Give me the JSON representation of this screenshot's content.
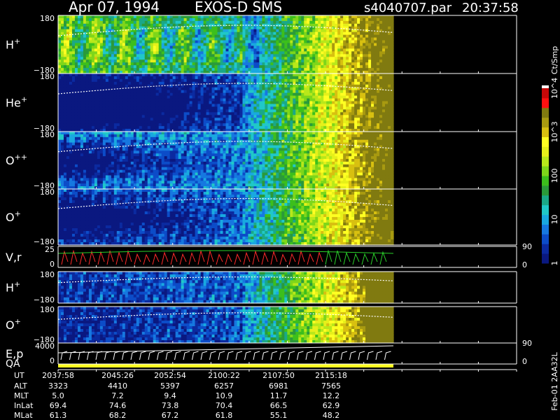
{
  "header": {
    "date": "Apr 07, 1994",
    "mission": "EXOS-D SMS",
    "file": "s4040707.par",
    "time": "20:37:58"
  },
  "chart_data": {
    "type": "heatmap",
    "title": "Apr 07, 1994   EXOS-D SMS",
    "colorbar": {
      "label": "Ct/Smp",
      "scale": "log",
      "range": [
        1,
        10000
      ],
      "ticks": [
        "1",
        "10",
        "100",
        "10^3",
        "10^4"
      ]
    },
    "panels": [
      {
        "id": "h-plus-1",
        "label": "H",
        "sup": "+",
        "ymin": "−180",
        "ymax": "180"
      },
      {
        "id": "he-plus",
        "label": "He",
        "sup": "+",
        "ymin": "−180",
        "ymax": "180"
      },
      {
        "id": "o-plusplus",
        "label": "O",
        "sup": "++",
        "ymin": "−180",
        "ymax": "180"
      },
      {
        "id": "o-plus-1",
        "label": "O",
        "sup": "+",
        "ymin": "−180",
        "ymax": "180"
      },
      {
        "id": "vr",
        "label": "V,r",
        "ymin": "0",
        "ymax": "25",
        "right_min": "0",
        "right_max": "90"
      },
      {
        "id": "h-plus-2",
        "label": "H",
        "sup": "+",
        "ymin": "−180",
        "ymax": "180"
      },
      {
        "id": "o-plus-2",
        "label": "O",
        "sup": "+",
        "ymin": "−180",
        "ymax": "180"
      },
      {
        "id": "ep",
        "label": "E,p",
        "ymin": "0",
        "ymax": "4000",
        "right_min": "0",
        "right_max": "90"
      }
    ],
    "qa_label": "QA",
    "footer_note": "Feb-01 2AA32L",
    "ephemeris": {
      "row_labels": [
        "UT",
        "ALT",
        "MLT",
        "InLat",
        "MLat"
      ],
      "columns": [
        [
          "2037:58",
          "3323",
          "5.0",
          "69.4",
          "61.3"
        ],
        [
          "2045:26",
          "4410",
          "7.2",
          "74.6",
          "68.2"
        ],
        [
          "2052:54",
          "5397",
          "9.4",
          "73.8",
          "67.2"
        ],
        [
          "2100:22",
          "6257",
          "10.9",
          "70.4",
          "61.8"
        ],
        [
          "2107:50",
          "6981",
          "11.7",
          "66.5",
          "55.1"
        ],
        [
          "2115:18",
          "7565",
          "12.2",
          "62.9",
          "48.2"
        ]
      ]
    }
  }
}
